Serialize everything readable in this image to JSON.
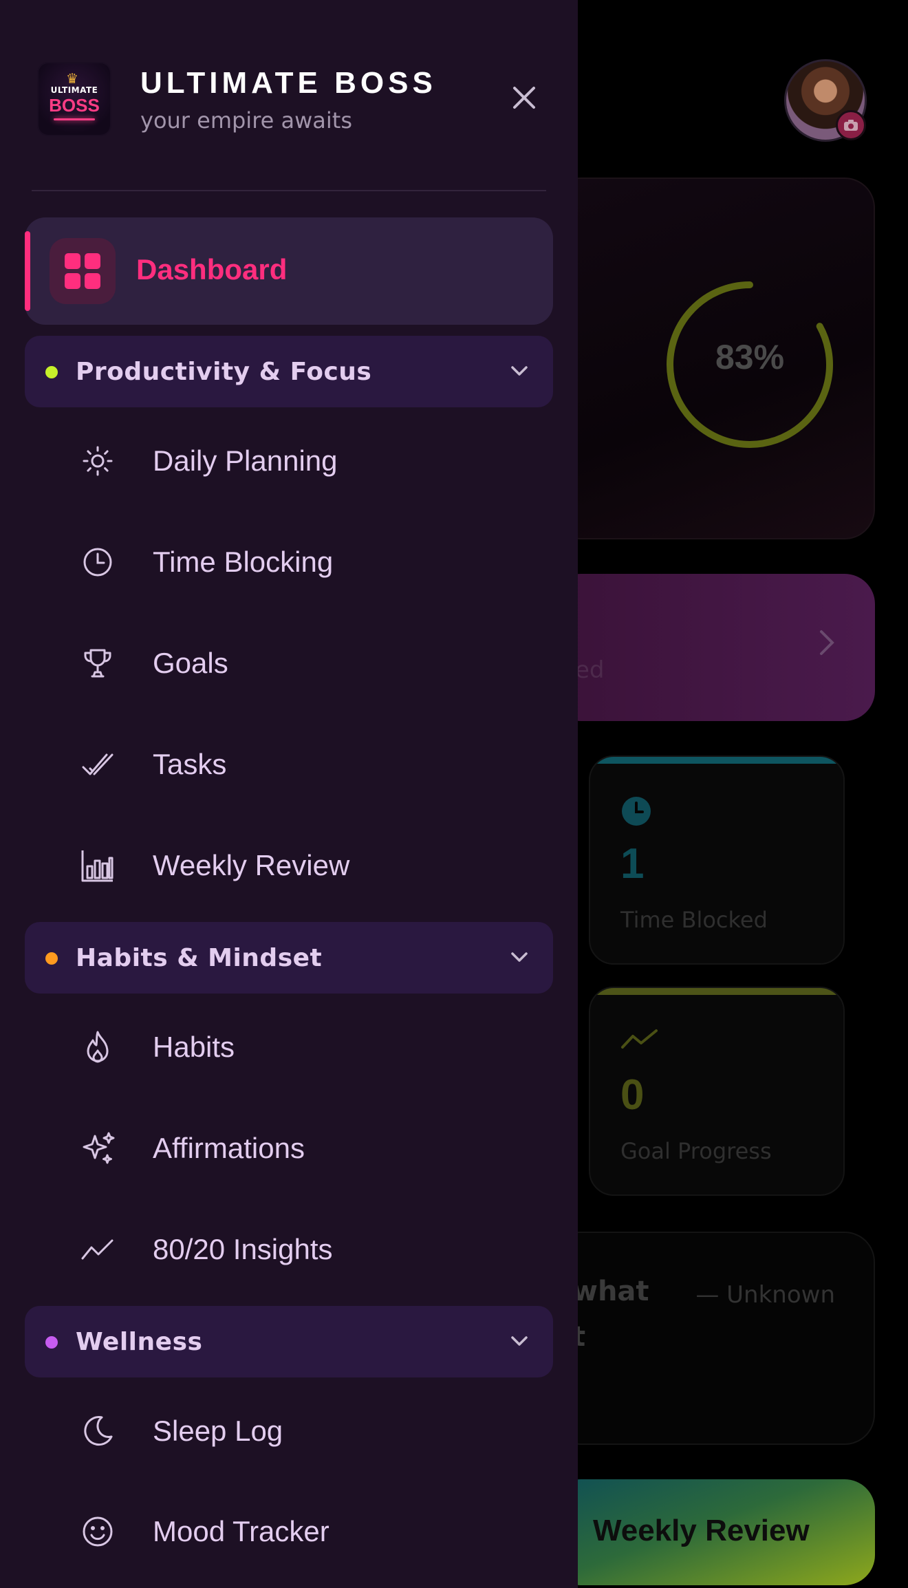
{
  "app": {
    "title": "ULTIMATE BOSS",
    "subtitle": "your empire awaits",
    "logo_text_top": "ULTIMATE",
    "logo_text_main": "BOSS"
  },
  "nav": {
    "active": {
      "label": "Dashboard",
      "icon": "grid-icon",
      "color": "#ff2e7e"
    },
    "sections": [
      {
        "label": "Productivity & Focus",
        "dot_color": "#c7f02a",
        "expanded": true,
        "items": [
          {
            "label": "Daily Planning",
            "icon": "sun-icon"
          },
          {
            "label": "Time Blocking",
            "icon": "clock-icon"
          },
          {
            "label": "Goals",
            "icon": "trophy-icon"
          },
          {
            "label": "Tasks",
            "icon": "double-check-icon"
          },
          {
            "label": "Weekly Review",
            "icon": "bar-chart-icon"
          }
        ]
      },
      {
        "label": "Habits & Mindset",
        "dot_color": "#ff9a1f",
        "expanded": true,
        "items": [
          {
            "label": "Habits",
            "icon": "flame-icon"
          },
          {
            "label": "Affirmations",
            "icon": "sparkles-icon"
          },
          {
            "label": "80/20 Insights",
            "icon": "trend-line-icon"
          }
        ]
      },
      {
        "label": "Wellness",
        "dot_color": "#c65cf0",
        "expanded": true,
        "items": [
          {
            "label": "Sleep Log",
            "icon": "moon-icon"
          },
          {
            "label": "Mood Tracker",
            "icon": "smile-icon"
          }
        ]
      }
    ]
  },
  "background": {
    "progress_percent": "83%",
    "progress_value": 0.83,
    "banner_fragment": "ed",
    "stats": [
      {
        "value": "1",
        "label": "Time Blocked",
        "icon": "clock-icon",
        "accent": "#0e5560"
      },
      {
        "value": "0",
        "label": "Goal Progress",
        "icon": "trend-line-icon",
        "accent": "#4d5418"
      }
    ],
    "quote_line_1": "what",
    "quote_line_2": "t",
    "quote_author": "— Unknown",
    "weekly_button": "Weekly Review"
  }
}
